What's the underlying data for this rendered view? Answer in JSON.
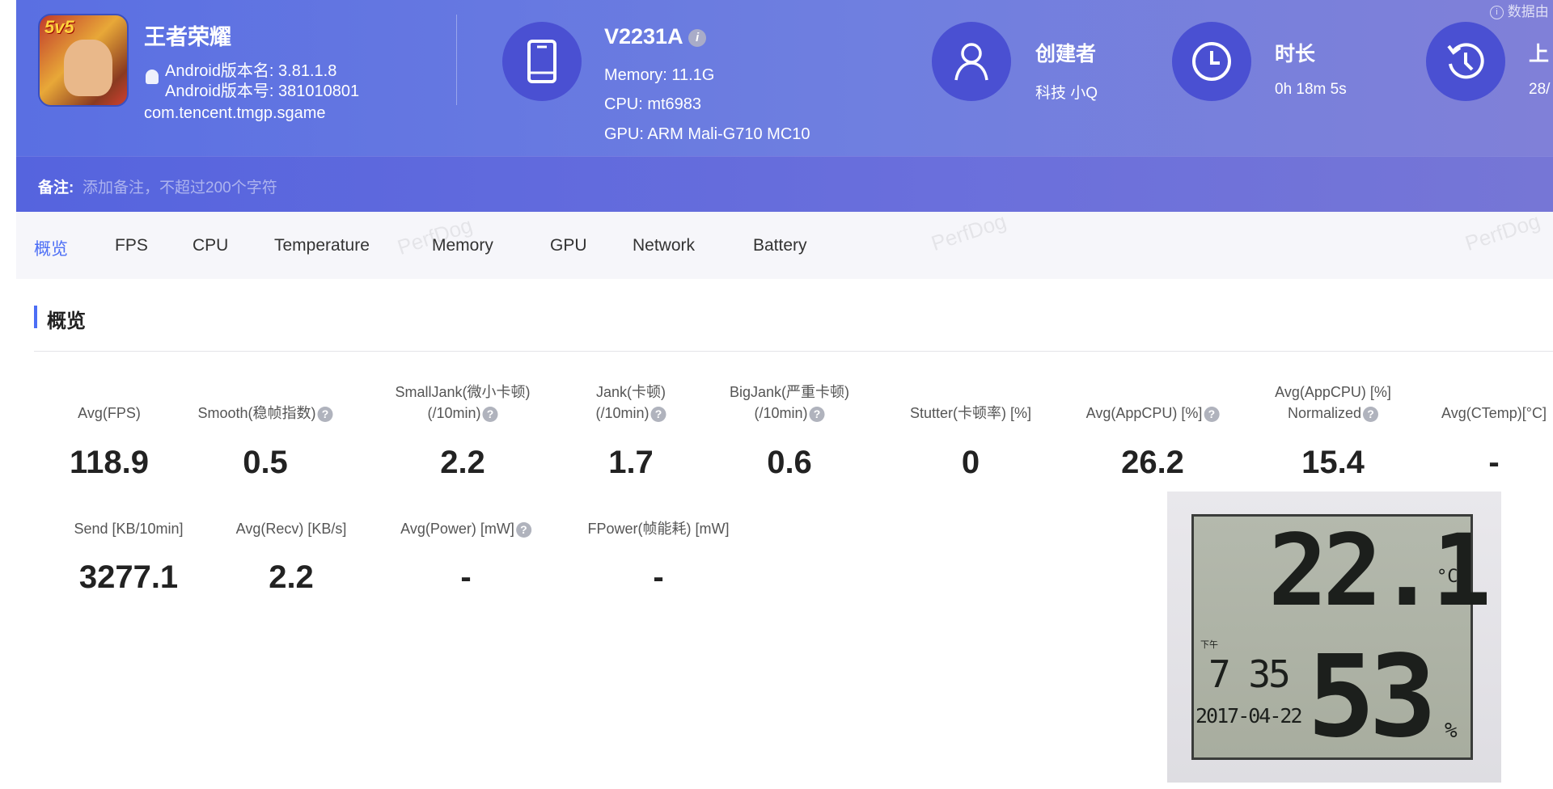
{
  "app": {
    "name": "王者荣耀",
    "version_name": "Android版本名: 3.81.1.8",
    "version_code": "Android版本号: 381010801",
    "package": "com.tencent.tmgp.sgame",
    "icon_text": "5v5"
  },
  "device": {
    "model": "V2231A",
    "memory": "Memory: 11.1G",
    "cpu": "CPU: mt6983",
    "gpu": "GPU: ARM Mali-G710 MC10"
  },
  "creator": {
    "label": "创建者",
    "value": "科技 小Q"
  },
  "duration": {
    "label": "时长",
    "value": "0h 18m 5s"
  },
  "upload": {
    "label": "上",
    "value": "28/"
  },
  "top_notice": "数据由",
  "notes": {
    "label": "备注:",
    "placeholder": "添加备注，不超过200个字符"
  },
  "tabs": [
    "概览",
    "FPS",
    "CPU",
    "Temperature",
    "Memory",
    "GPU",
    "Network",
    "Battery"
  ],
  "watermark": "PerfDog",
  "section_title": "概览",
  "metrics_row1": [
    {
      "label": "Avg(FPS)",
      "value": "118.9"
    },
    {
      "label": "Smooth(稳帧指数)",
      "value": "0.5",
      "help": true
    },
    {
      "label1": "SmallJank(微小卡顿)",
      "label": "(/10min)",
      "value": "2.2",
      "help": true
    },
    {
      "label1": "Jank(卡顿)",
      "label": "(/10min)",
      "value": "1.7",
      "help": true
    },
    {
      "label1": "BigJank(严重卡顿)",
      "label": "(/10min)",
      "value": "0.6",
      "help": true
    },
    {
      "label": "Stutter(卡顿率) [%]",
      "value": "0"
    },
    {
      "label": "Avg(AppCPU) [%]",
      "value": "26.2",
      "help": true
    },
    {
      "label1": "Avg(AppCPU) [%]",
      "label": "Normalized",
      "value": "15.4",
      "help": true
    },
    {
      "label": "Avg(CTemp)[°C]",
      "value": "-"
    }
  ],
  "metrics_row2": [
    {
      "label": "Send [KB/10min]",
      "value": "3277.1"
    },
    {
      "label": "Avg(Recv) [KB/s]",
      "value": "2.2"
    },
    {
      "label": "Avg(Power) [mW]",
      "value": "-",
      "help": true
    },
    {
      "label": "FPower(帧能耗) [mW]",
      "value": "-"
    }
  ],
  "thermometer": {
    "temperature": "22.1",
    "temp_unit": "°C",
    "humidity": "53",
    "humidity_unit": "%",
    "ampm": "下午",
    "time": "7 35",
    "date": "2017-04-22"
  },
  "colors": {
    "accent": "#4c6ef5",
    "header": "#5a6fe2",
    "circle": "#4a50d2"
  }
}
